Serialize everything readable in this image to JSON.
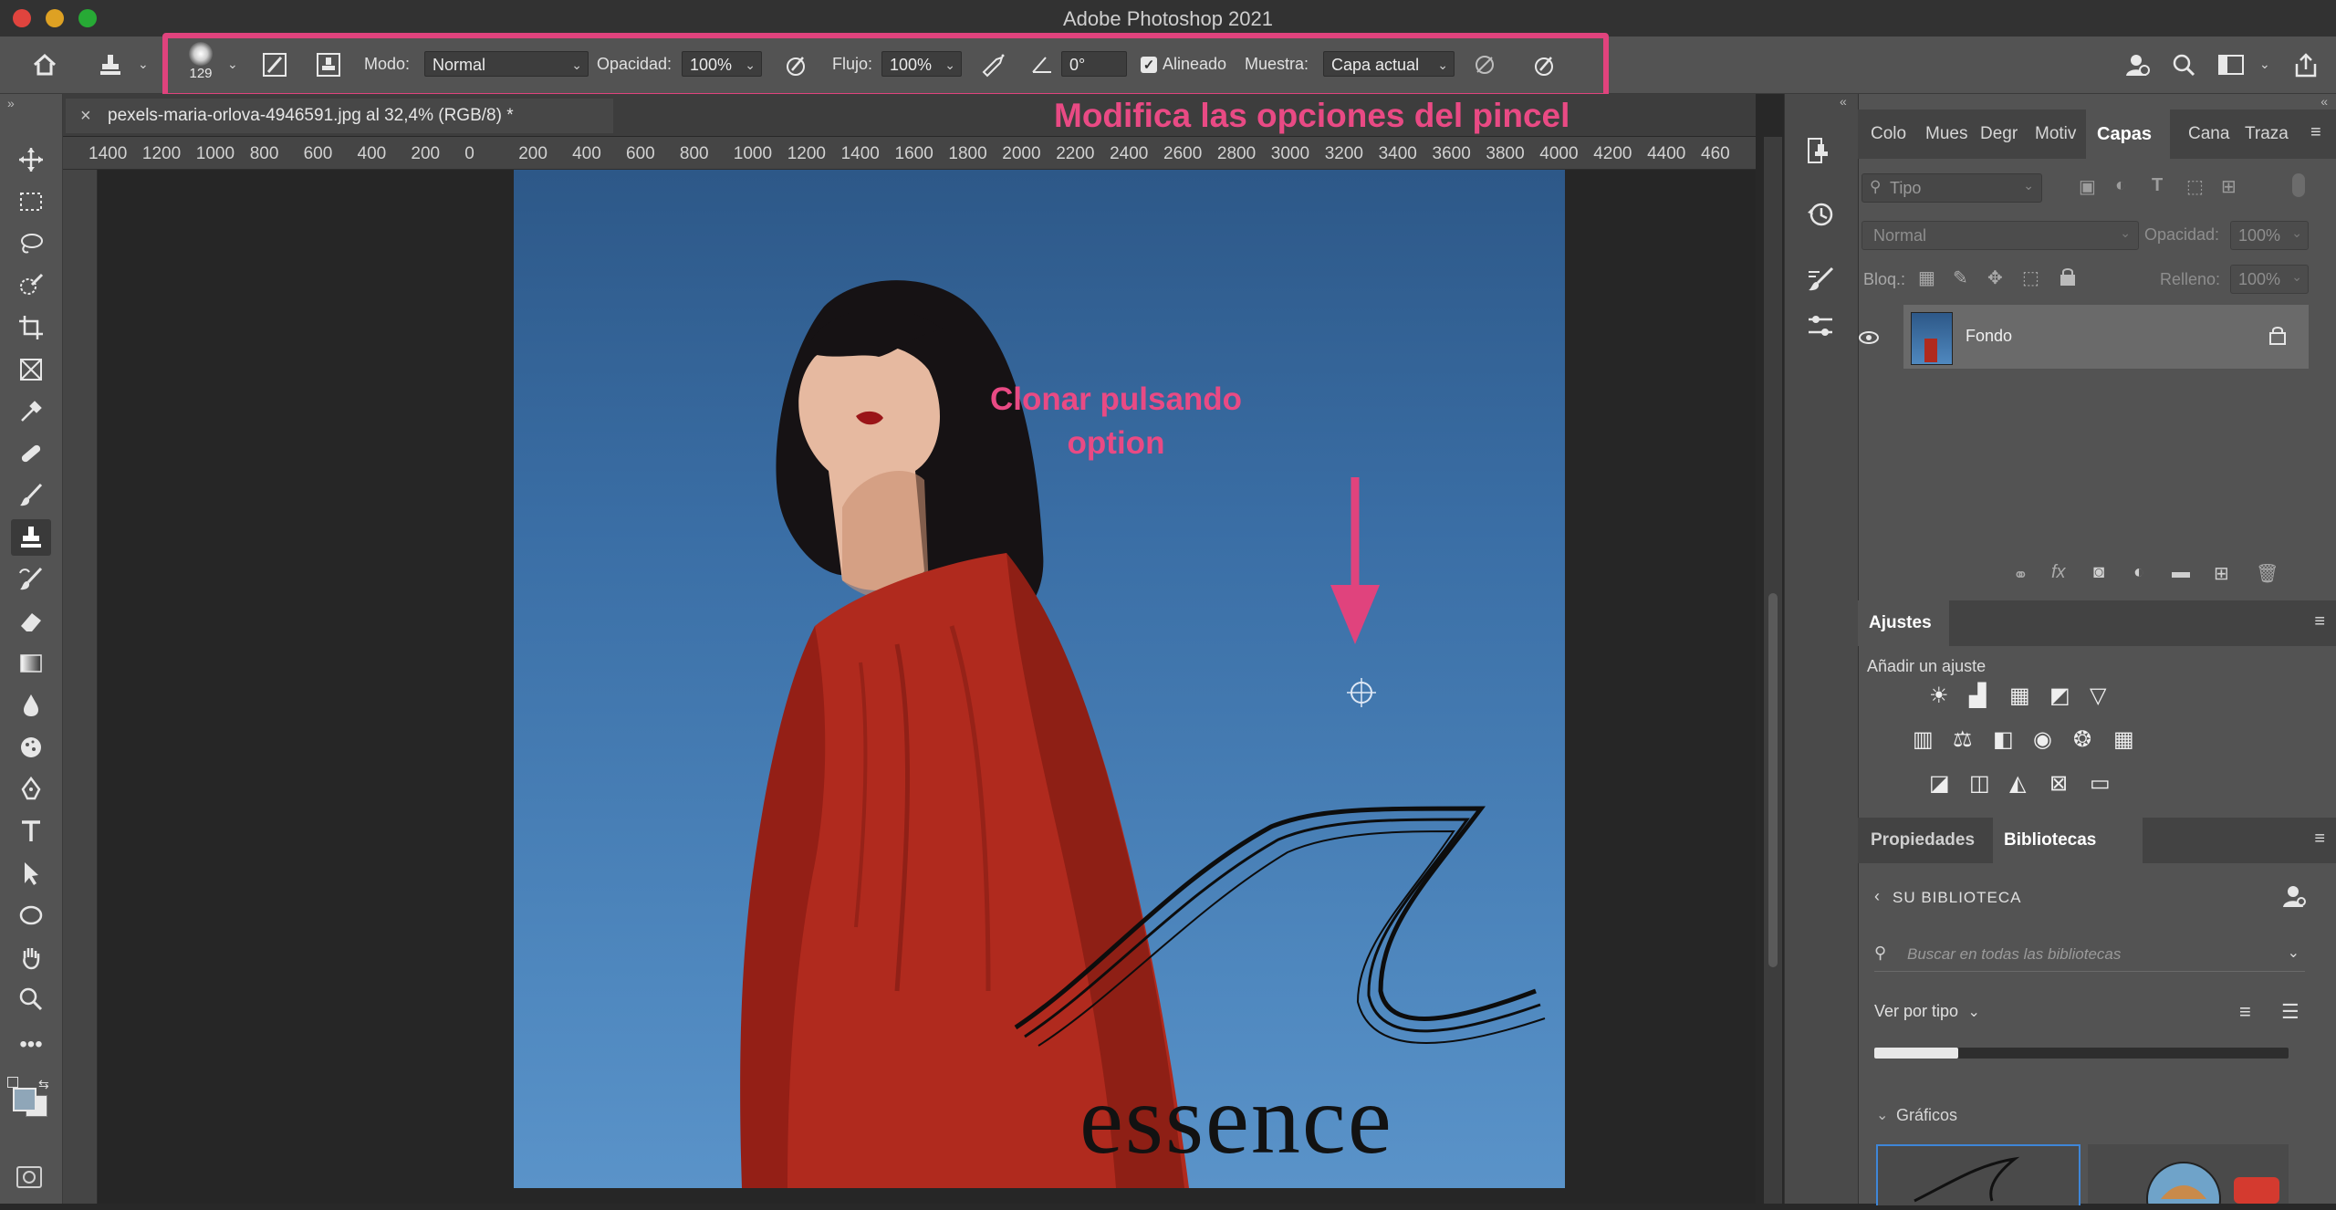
{
  "window": {
    "title": "Adobe Photoshop 2021"
  },
  "options": {
    "brush_size": "129",
    "mode_label": "Modo:",
    "mode_value": "Normal",
    "opacity_label": "Opacidad:",
    "opacity_value": "100%",
    "flow_label": "Flujo:",
    "flow_value": "100%",
    "angle_value": "0°",
    "aligned_label": "Alineado",
    "aligned_checked": true,
    "sample_label": "Muestra:",
    "sample_value": "Capa actual"
  },
  "annotations": {
    "options_note": "Modifica las opciones del pincel",
    "clone_note_line1": "Clonar pulsando",
    "clone_note_line2": "option",
    "accent_color": "#e0437d"
  },
  "document": {
    "tab_title": "pexels-maria-orlova-4946591.jpg al 32,4% (RGB/8) *",
    "close_glyph": "×",
    "ruler_labels": [
      "1400",
      "1200",
      "1000",
      "800",
      "600",
      "400",
      "200",
      "0",
      "200",
      "400",
      "600",
      "800",
      "1000",
      "1200",
      "1400",
      "1600",
      "1800",
      "2000",
      "2200",
      "2400",
      "2600",
      "2800",
      "3000",
      "3200",
      "3400",
      "3600",
      "3800",
      "4000",
      "4200",
      "4400",
      "460"
    ],
    "essence_text": "essence"
  },
  "panels": {
    "top_tabs": [
      "Colo",
      "Mues",
      "Degr",
      "Motiv",
      "Capas",
      "Cana",
      "Traza"
    ],
    "active_top_tab": "Capas",
    "filter_placeholder": "Tipo",
    "blend_mode": "Normal",
    "opacity_label": "Opacidad:",
    "opacity_value": "100%",
    "lock_label": "Bloq.:",
    "fill_label": "Relleno:",
    "fill_value": "100%",
    "layer_name": "Fondo",
    "adjustments_tab": "Ajustes",
    "add_adjustment": "Añadir un ajuste",
    "props_tab": "Propiedades",
    "libraries_tab": "Bibliotecas",
    "library_name": "SU BIBLIOTECA",
    "library_search_placeholder": "Buscar en todas las bibliotecas",
    "view_by": "Ver por tipo",
    "graphics_label": "Gráficos"
  }
}
